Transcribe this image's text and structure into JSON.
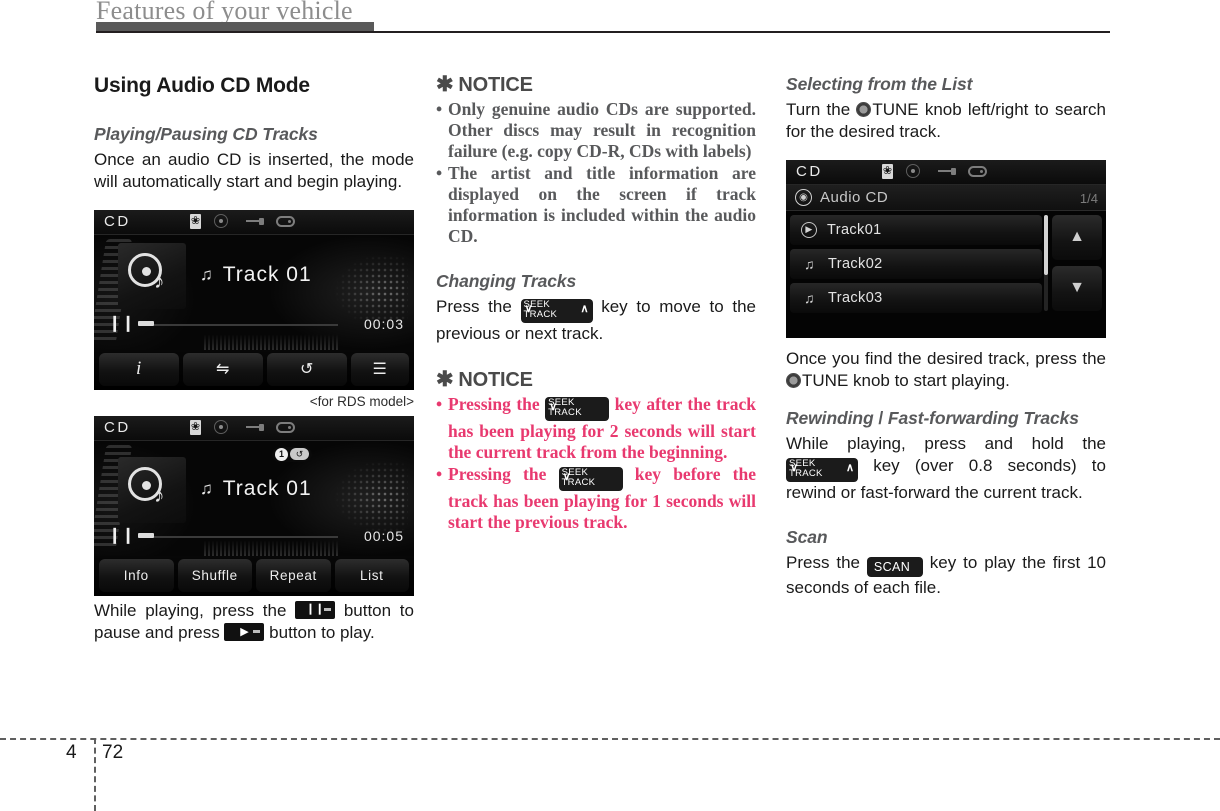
{
  "header": {
    "title": "Features of your vehicle"
  },
  "footer": {
    "chapter": "4",
    "page": "72"
  },
  "column_left": {
    "section_title": "Using Audio CD Mode",
    "subhead_playing": "Playing/Pausing CD Tracks",
    "body_playing": "Once an audio CD is inserted, the mode will automatically start and begin playing.",
    "caption_rds": "<for RDS model>",
    "body_pause_1": "While playing, press the",
    "body_pause_2": "button to pause and press",
    "body_pause_3": "button to play.",
    "cd_screen_1": {
      "mode_label": "CD",
      "status_icons": [
        "bluetooth-icon",
        "disc-icon",
        "usb-icon",
        "aux-icon"
      ],
      "track_title": "Track 01",
      "elapsed_time": "00:03",
      "transport_state": "pause-icon",
      "buttons": [
        "info-icon",
        "shuffle-icon",
        "repeat-icon",
        "list-icon"
      ]
    },
    "cd_screen_2": {
      "mode_label": "CD",
      "status_icons": [
        "bluetooth-icon",
        "disc-icon",
        "usb-icon",
        "aux-icon"
      ],
      "repeat_badge": "1",
      "track_title": "Track 01",
      "elapsed_time": "00:05",
      "transport_state": "pause-icon",
      "buttons": [
        "Info",
        "Shuffle",
        "Repeat",
        "List"
      ]
    }
  },
  "column_middle": {
    "notice_1": {
      "heading": "NOTICE",
      "star": "✱",
      "items": [
        "Only genuine audio CDs are supported. Other discs may result in recognition failure (e.g. copy CD-R, CDs with labels)",
        "The artist and title information are displayed on the screen if track information is included within the audio CD."
      ]
    },
    "subhead_changing": "Changing Tracks",
    "body_changing_1": "Press the",
    "body_changing_2": "key to move to the previous or next track.",
    "notice_2": {
      "heading": "NOTICE",
      "star": "✱",
      "item_1_a": "Pressing the",
      "item_1_b": "key after the track has been playing for 2 seconds will start the current track from the beginning.",
      "item_2_a": "Pressing the",
      "item_2_b": "key before the track has been playing for 1 seconds will start the previous track."
    },
    "key_seek_track": {
      "top": "SEEK",
      "bottom": "TRACK",
      "chevron_down": "∨",
      "chevron_up": "∧"
    }
  },
  "column_right": {
    "subhead_list": "Selecting from the List",
    "body_list_1": "Turn the",
    "body_list_2": "TUNE knob left/right to search for the desired track.",
    "body_list_3": "Once you find the desired track, press the",
    "body_list_4": "TUNE knob to start playing.",
    "list_screen": {
      "mode_label": "CD",
      "status_icons": [
        "bluetooth-icon",
        "disc-icon",
        "usb-icon",
        "aux-icon"
      ],
      "source_title": "Audio CD",
      "page_indicator": "1/4",
      "rows": [
        {
          "icon": "play-icon",
          "label": "Track01"
        },
        {
          "icon": "music-note-icon",
          "label": "Track02"
        },
        {
          "icon": "music-note-icon",
          "label": "Track03"
        }
      ],
      "scroll_up": "▲",
      "scroll_down": "▼",
      "back_button": "↩"
    },
    "subhead_rewind_a": "Rewinding",
    "subhead_rewind_slash": " / ",
    "subhead_rewind_b": "Fast-forwarding Tracks",
    "body_rewind_1": "While playing, press and hold the",
    "body_rewind_2": "key (over 0.8 seconds) to rewind or fast-forward the current track.",
    "subhead_scan": "Scan",
    "body_scan_1": "Press the",
    "body_scan_2": "key to play the first 10 seconds of each file.",
    "key_scan": "SCAN"
  },
  "colors": {
    "accent_red": "#e8396f",
    "heading_gray": "#58595b",
    "header_gray": "#8d8d8d"
  }
}
